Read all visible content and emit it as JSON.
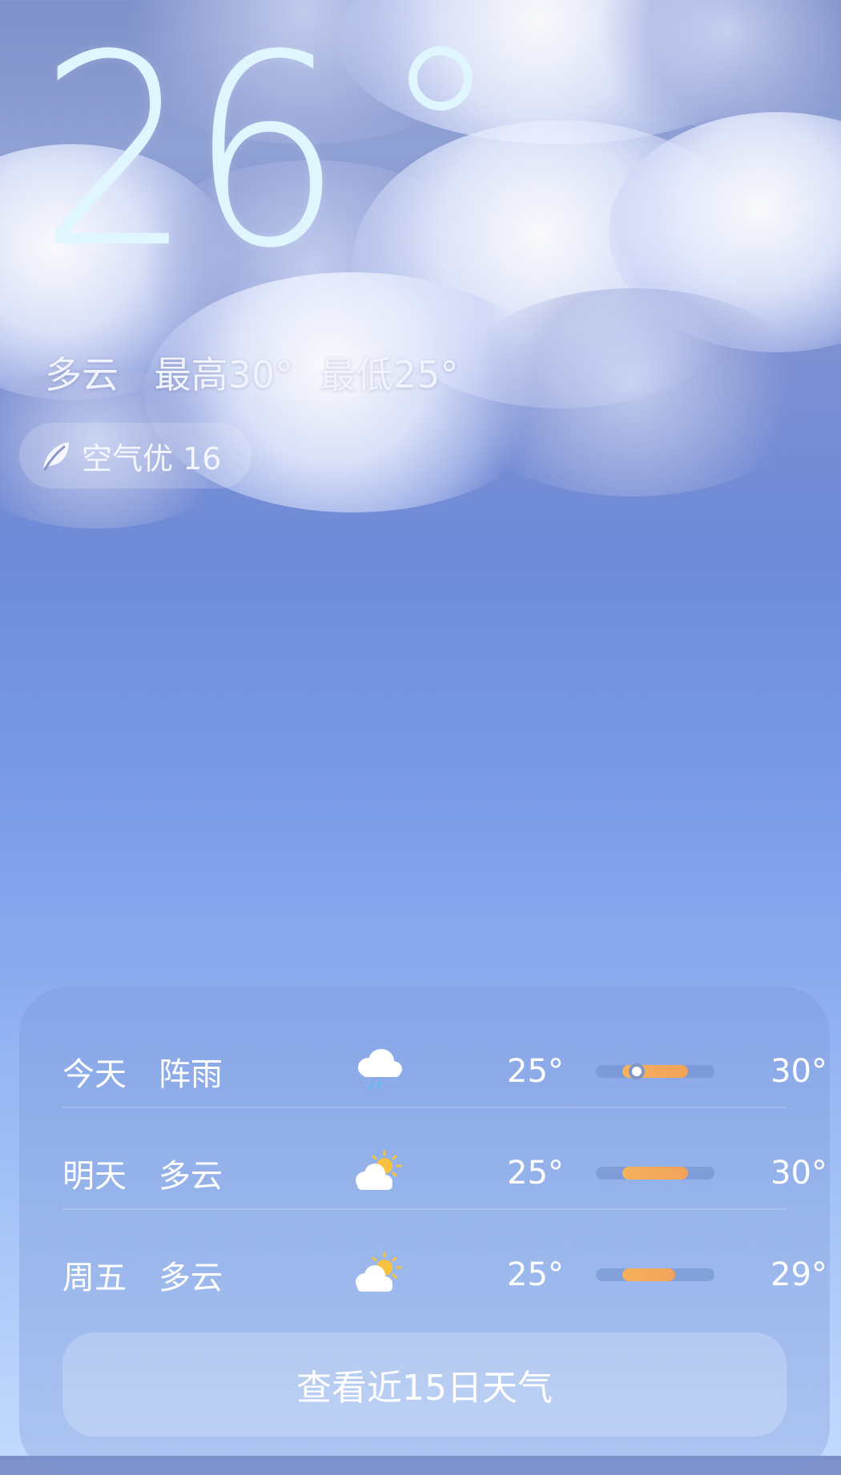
{
  "current": {
    "temperature": "26",
    "condition": "多云",
    "high": "最高30°",
    "low": "最低25°"
  },
  "air_quality": {
    "label": "空气优",
    "value": "16",
    "icon": "leaf-icon"
  },
  "forecast": [
    {
      "day": "今天",
      "condition": "阵雨",
      "icon": "cloud-rain-icon",
      "low": "25°",
      "high": "30°",
      "low_value": 25,
      "high_value": 30,
      "current_value": 26
    },
    {
      "day": "明天",
      "condition": "多云",
      "icon": "partly-cloudy-icon",
      "low": "25°",
      "high": "30°",
      "low_value": 25,
      "high_value": 30
    },
    {
      "day": "周五",
      "condition": "多云",
      "icon": "partly-cloudy-icon",
      "low": "25°",
      "high": "29°",
      "low_value": 25,
      "high_value": 29
    }
  ],
  "more_button": "查看近15日天气",
  "colors": {
    "bar_fill": "#f4aa5b",
    "bar_track": "#6e8cc8",
    "temp_text": "#dff6ff"
  }
}
